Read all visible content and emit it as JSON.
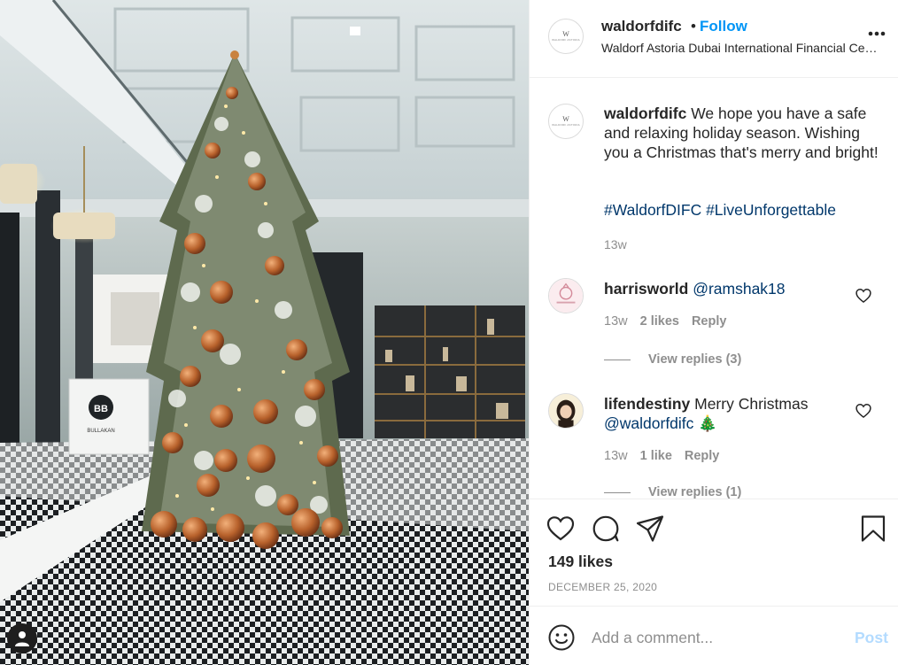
{
  "header": {
    "username": "waldorfdifc",
    "separator": "•",
    "follow_label": "Follow",
    "location": "Waldorf Astoria Dubai International Financial Centre",
    "more_icon": "more-options-icon"
  },
  "photo": {
    "sign_text": "BB",
    "sign_subtext": "BULLAKAN"
  },
  "caption": {
    "username": "waldorfdifc",
    "text": "We hope you have a safe and relaxing holiday season. Wishing you a Christmas that's merry and bright!",
    "hashtags": "#WaldorfDIFC #LiveUnforgettable",
    "time": "13w"
  },
  "comments": [
    {
      "username": "harrisworld",
      "mention": "@ramshak18",
      "text": "",
      "time": "13w",
      "likes": "2 likes",
      "reply_label": "Reply",
      "view_replies": "View replies (3)"
    },
    {
      "username": "lifendestiny",
      "text": "Merry Christmas",
      "mention": "@waldorfdifc",
      "emoji": "🎄",
      "time": "13w",
      "likes": "1 like",
      "reply_label": "Reply",
      "view_replies": "View replies (1)"
    }
  ],
  "actions": {
    "likes": "149 likes",
    "date": "DECEMBER 25, 2020"
  },
  "add_comment": {
    "placeholder": "Add a comment...",
    "post_label": "Post"
  },
  "colors": {
    "link_blue": "#0095f6",
    "hashtag_blue": "#00376b",
    "muted": "#8e8e8e",
    "post_disabled": "#b3dbff"
  }
}
